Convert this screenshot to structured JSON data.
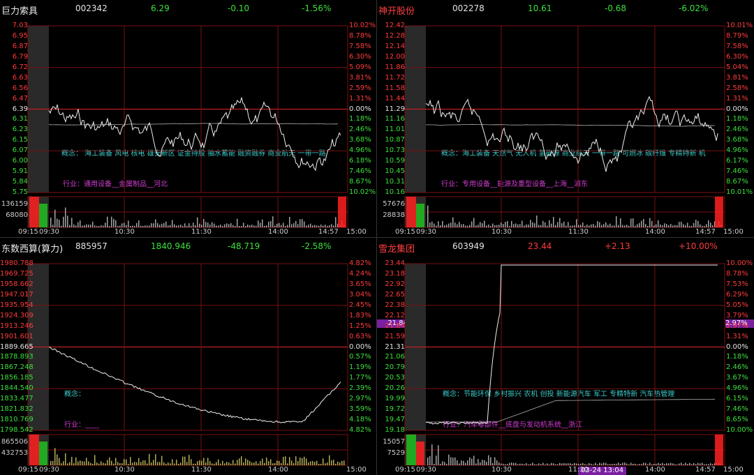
{
  "panels": [
    {
      "name": "巨力索具",
      "code": "002342",
      "price": "6.29",
      "change": "-0.10",
      "pct": "-1.56%",
      "trend": "down",
      "yleft": [
        "7.03",
        "6.95",
        "6.87",
        "6.79",
        "6.72",
        "6.63",
        "6.56",
        "6.47",
        "6.39",
        "6.31",
        "6.23",
        "6.15",
        "6.07",
        "6.00",
        "5.91",
        "5.84",
        "5.75"
      ],
      "yright": [
        "10.02%",
        "8.78%",
        "7.58%",
        "6.30%",
        "5.09%",
        "3.81%",
        "2.59%",
        "1.31%",
        "0.00%",
        "1.18%",
        "2.46%",
        "3.68%",
        "4.96%",
        "6.18%",
        "7.46%",
        "8.67%",
        "10.02%"
      ],
      "vol": [
        "136159",
        "68080"
      ],
      "times": [
        "09:15",
        "09:30",
        "10:30",
        "11:30",
        "14:00",
        "14:57",
        "15:00"
      ],
      "concept": "概念：  海工装备  风电  核电  雄安新区  证金持股  抽水蓄能  融资融券  商业航天  一带一路",
      "industry": "行业：通用设备__金属制品__河北"
    },
    {
      "name": "神开股份",
      "code": "002278",
      "price": "10.61",
      "change": "-0.68",
      "pct": "-6.02%",
      "trend": "down",
      "yleft": [
        "12.42",
        "12.28",
        "12.14",
        "12.00",
        "11.86",
        "11.72",
        "11.58",
        "11.44",
        "11.29",
        "11.16",
        "11.01",
        "10.87",
        "10.73",
        "10.59",
        "10.45",
        "10.31",
        "10.16"
      ],
      "yright": [
        "10.01%",
        "8.79%",
        "7.58%",
        "6.30%",
        "5.04%",
        "3.81%",
        "2.58%",
        "1.31%",
        "0.00%",
        "1.18%",
        "2.46%",
        "3.68%",
        "4.96%",
        "6.17%",
        "7.46%",
        "8.67%",
        "10.01%"
      ],
      "vol": [
        "57676",
        "28838"
      ],
      "times": [
        "09:15",
        "09:30",
        "10:30",
        "11:30",
        "14:00",
        "14:57",
        "15:00"
      ],
      "concept": "概念：海工装备  天然气  无人机  氢能源  商业航天  一带一路  可燃冰  碳纤维  专精特新  机",
      "industry": "行业：专用设备__能源及重型设备__上海__浦东"
    },
    {
      "name": "东数西算(算力)",
      "code": "885957",
      "price": "1840.946",
      "change": "-48.719",
      "pct": "-2.58%",
      "trend": "down",
      "yleft": [
        "1980.788",
        "1969.725",
        "1958.662",
        "1947.017",
        "1935.954",
        "1924.309",
        "1913.246",
        "1901.601",
        "1889.665",
        "1878.893",
        "1867.248",
        "1856.185",
        "1844.540",
        "1833.477",
        "1821.832",
        "1810.769",
        "1798.542"
      ],
      "yright": [
        "4.82%",
        "4.24%",
        "3.65%",
        "3.04%",
        "2.45%",
        "1.83%",
        "1.25%",
        "0.63%",
        "0.00%",
        "0.57%",
        "1.19%",
        "1.77%",
        "2.39%",
        "2.97%",
        "3.59%",
        "4.18%",
        "4.82%"
      ],
      "vol": [
        "865506",
        "432753"
      ],
      "times": [
        "09:15",
        "09:30",
        "10:30",
        "11:30",
        "14:00",
        "15:00"
      ],
      "concept": "概念：",
      "industry": "行业：____"
    },
    {
      "name": "雪龙集团",
      "code": "603949",
      "price": "23.44",
      "change": "+2.13",
      "pct": "+10.00%",
      "trend": "up",
      "yleft": [
        "23.44",
        "23.18",
        "22.92",
        "22.65",
        "22.38",
        "22.12",
        "21.84",
        "21.59",
        "21.31",
        "21.06",
        "20.79",
        "20.53",
        "20.26",
        "19.99",
        "19.72",
        "19.47",
        "19.18"
      ],
      "yright": [
        "10.00%",
        "8.78%",
        "7.53%",
        "6.29%",
        "5.05%",
        "3.79%",
        "2.97%",
        "1.31%",
        "0.00%",
        "1.18%",
        "2.46%",
        "3.67%",
        "4.96%",
        "6.15%",
        "7.46%",
        "8.65%",
        "10.00%"
      ],
      "vol": [
        "15057",
        "7529"
      ],
      "times": [
        "09:15",
        "09:30",
        "10:30",
        "11:30",
        "14:00",
        "14:57",
        "15:00"
      ],
      "concept": "概念：节能环保  乡村振兴  农机  创投  新能源汽车  军工  专精特新  汽车热管理",
      "industry": "行业：汽车零部件__底盘与发动机系统__浙江",
      "highlight_left": "21.84",
      "highlight_right": "2.97%",
      "cursor_date": "03-24 13:04"
    }
  ]
}
